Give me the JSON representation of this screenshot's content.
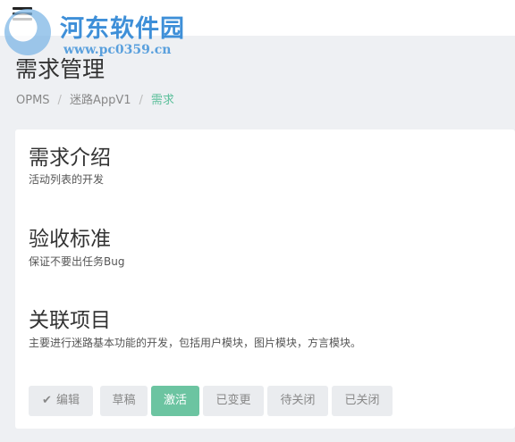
{
  "watermark": {
    "title": "河东软件园",
    "url": "www.pc0359.cn"
  },
  "header": {
    "menu_icon": "hamburger-menu-icon",
    "title": "需求管理"
  },
  "breadcrumb": {
    "items": [
      "OPMS",
      "迷路AppV1",
      "需求"
    ],
    "separator": "/"
  },
  "sections": [
    {
      "title": "需求介绍",
      "text": "活动列表的开发"
    },
    {
      "title": "验收标准",
      "text": "保证不要出任务Bug"
    },
    {
      "title": "关联项目",
      "text": "主要进行迷路基本功能的开发，包括用户模块，图片模块，方言模块。"
    }
  ],
  "actions": {
    "edit": {
      "label": "编辑",
      "icon": "check-icon"
    },
    "draft": "草稿",
    "activate": "激活",
    "changed": "已变更",
    "pending_close": "待关闭",
    "closed": "已关闭"
  },
  "colors": {
    "accent": "#6cc4a1",
    "breadcrumb_active": "#5bbf9a",
    "background": "#eef0f3"
  }
}
